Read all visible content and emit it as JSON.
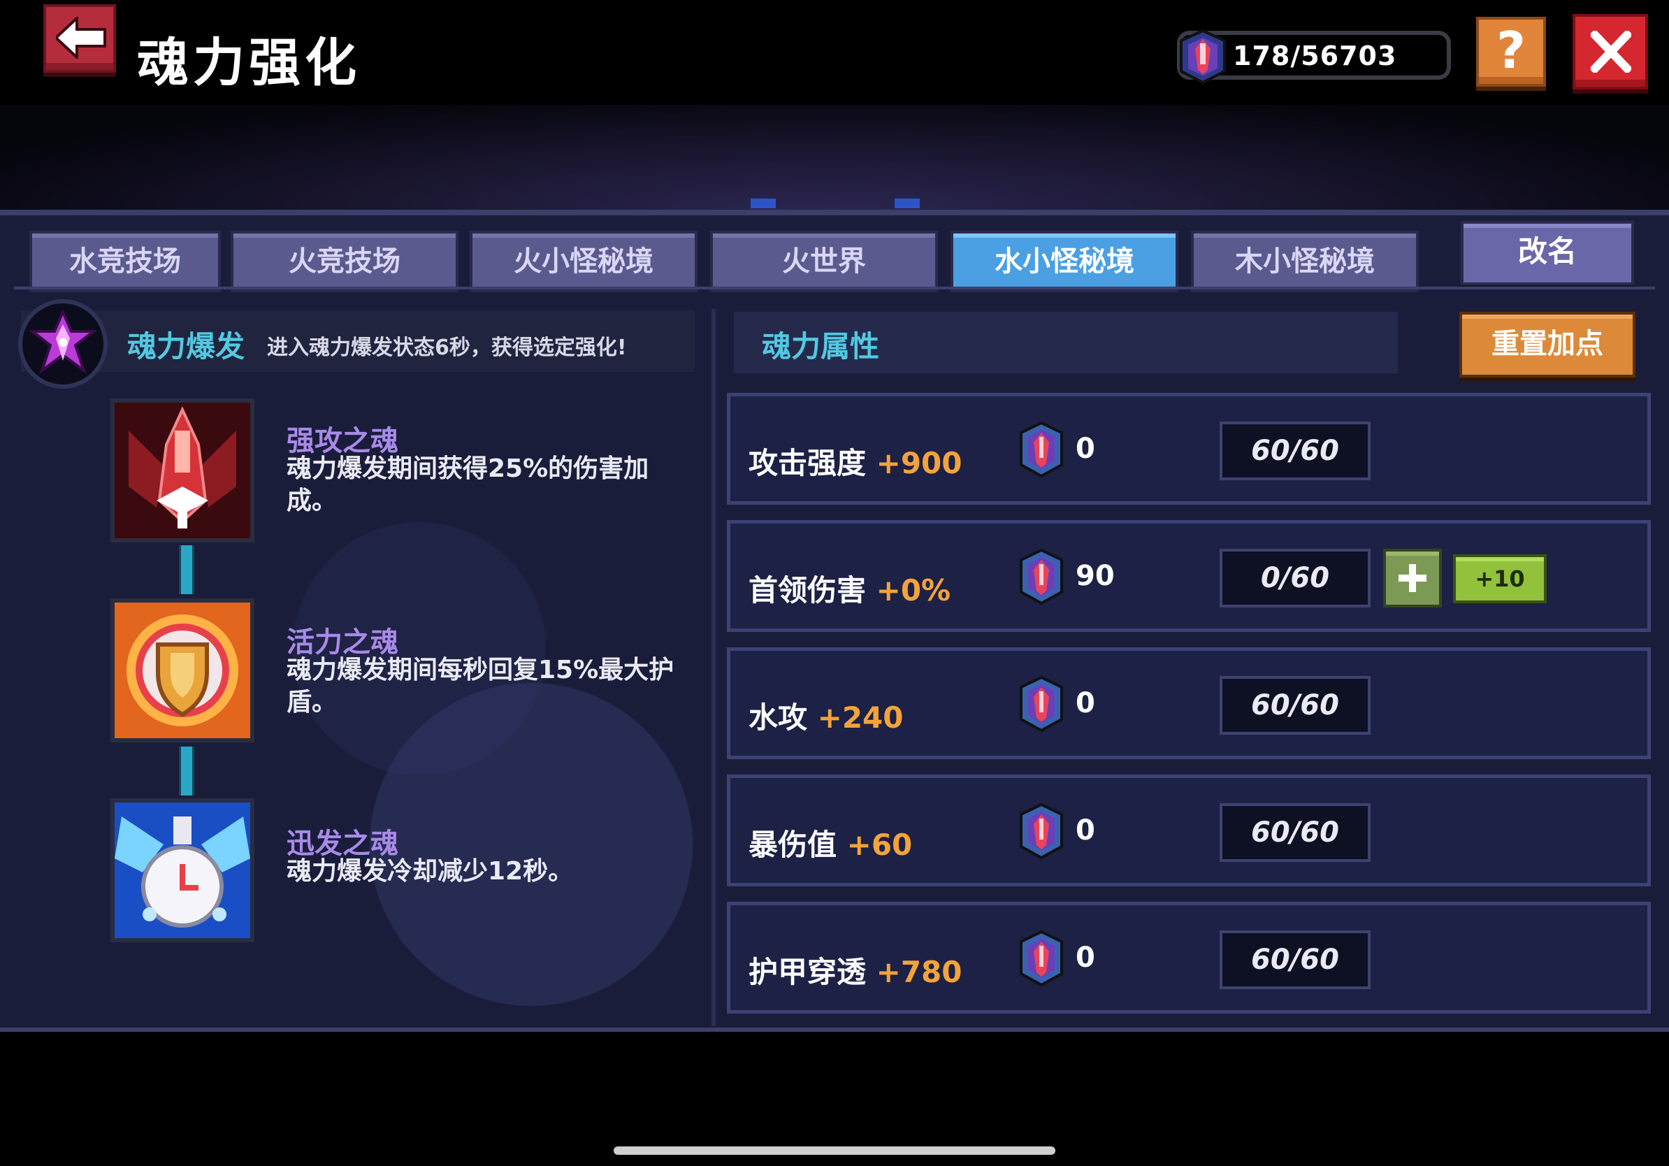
{
  "header": {
    "title": "魂力强化",
    "currency": "178/56703"
  },
  "help_label": "?",
  "tabs": [
    {
      "label": "水竞技场",
      "active": false
    },
    {
      "label": "火竞技场",
      "active": false
    },
    {
      "label": "火小怪秘境",
      "active": false
    },
    {
      "label": "火世界",
      "active": false
    },
    {
      "label": "水小怪秘境",
      "active": true
    },
    {
      "label": "木小怪秘境",
      "active": false
    }
  ],
  "rename_label": "改名",
  "burst": {
    "name": "魂力爆发",
    "desc": "进入魂力爆发状态6秒，获得选定强化!"
  },
  "skills": [
    {
      "name": "强攻之魂",
      "desc": "魂力爆发期间获得25%的伤害加成。",
      "icon": "red-spaceship-icon"
    },
    {
      "name": "活力之魂",
      "desc": "魂力爆发期间每秒回复15%最大护盾。",
      "icon": "shield-icon"
    },
    {
      "name": "迅发之魂",
      "desc": "魂力爆发冷却减少12秒。",
      "icon": "clock-icon"
    }
  ],
  "attributes": {
    "title": "魂力属性",
    "reset_label": "重置加点",
    "rows": [
      {
        "name": "攻击强度",
        "bonus": "+900",
        "cost": "0",
        "level": "60/60"
      },
      {
        "name": "首领伤害",
        "bonus": "+0%",
        "cost": "90",
        "level": "0/60",
        "plus_label": "+10"
      },
      {
        "name": "水攻",
        "bonus": "+240",
        "cost": "0",
        "level": "60/60"
      },
      {
        "name": "暴伤值",
        "bonus": "+60",
        "cost": "0",
        "level": "60/60"
      },
      {
        "name": "护甲穿透",
        "bonus": "+780",
        "cost": "0",
        "level": "60/60"
      }
    ]
  }
}
